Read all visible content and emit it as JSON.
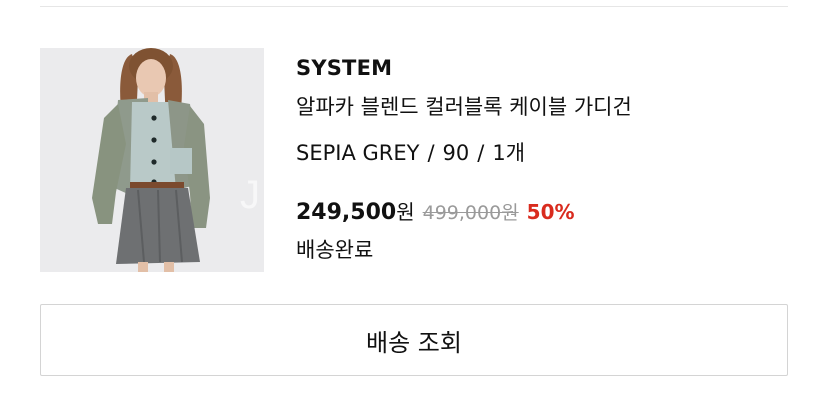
{
  "order_item": {
    "brand": "SYSTEM",
    "product_name": "알파카 블렌드 컬러블록 케이블 가디건",
    "option_color": "SEPIA GREY",
    "option_size": "90",
    "option_quantity": "1개",
    "option_separator": "/",
    "sale_price": "249,500",
    "sale_price_unit": "원",
    "original_price": "499,000원",
    "discount_rate": "50%",
    "delivery_status": "배송완료"
  },
  "actions": {
    "track_delivery_label": "배송 조회"
  },
  "colors": {
    "discount": "#d92b1e",
    "strikethrough_price": "#9a9a9a",
    "border": "#d4d4d4"
  }
}
